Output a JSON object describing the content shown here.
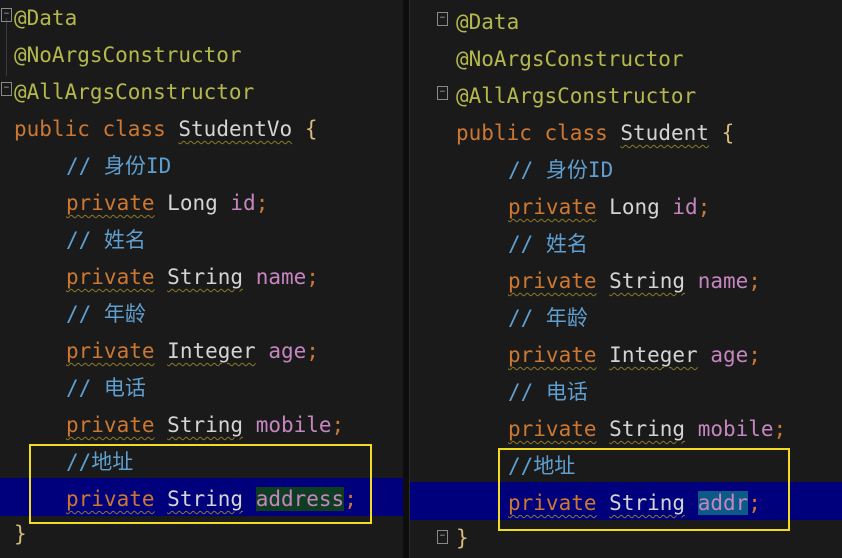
{
  "left": {
    "annotations": [
      "@Data",
      "@NoArgsConstructor",
      "@AllArgsConstructor"
    ],
    "class_decl": {
      "keyword1": "public",
      "keyword2": "class",
      "name": "StudentVo",
      "brace": "{"
    },
    "fields": [
      {
        "comment": "// 身份ID",
        "modifier": "private",
        "type": "Long",
        "name": "id",
        "semi": ";"
      },
      {
        "comment": "// 姓名",
        "modifier": "private",
        "type": "String",
        "name": "name",
        "semi": ";"
      },
      {
        "comment": "// 年龄",
        "modifier": "private",
        "type": "Integer",
        "name": "age",
        "semi": ";"
      },
      {
        "comment": "// 电话",
        "modifier": "private",
        "type": "String",
        "name": "mobile",
        "semi": ";"
      },
      {
        "comment": "//地址",
        "modifier": "private",
        "type": "String",
        "name": "address",
        "semi": ";"
      }
    ],
    "close_brace": "}"
  },
  "right": {
    "annotations": [
      "@Data",
      "@NoArgsConstructor",
      "@AllArgsConstructor"
    ],
    "class_decl": {
      "keyword1": "public",
      "keyword2": "class",
      "name": "Student",
      "brace": "{"
    },
    "fields": [
      {
        "comment": "// 身份ID",
        "modifier": "private",
        "type": "Long",
        "name": "id",
        "semi": ";"
      },
      {
        "comment": "// 姓名",
        "modifier": "private",
        "type": "String",
        "name": "name",
        "semi": ";"
      },
      {
        "comment": "// 年龄",
        "modifier": "private",
        "type": "Integer",
        "name": "age",
        "semi": ";"
      },
      {
        "comment": "// 电话",
        "modifier": "private",
        "type": "String",
        "name": "mobile",
        "semi": ";"
      },
      {
        "comment": "//地址",
        "modifier": "private",
        "type": "String",
        "name": "addr",
        "semi": ";"
      }
    ],
    "close_brace": "}"
  },
  "colors": {
    "annotation": "#b5b84c",
    "keyword": "#cc7832",
    "comment": "#5f9fd0",
    "field": "#c586c0",
    "highlight_box": "#f2dc22",
    "selection_row": "#00007c"
  }
}
